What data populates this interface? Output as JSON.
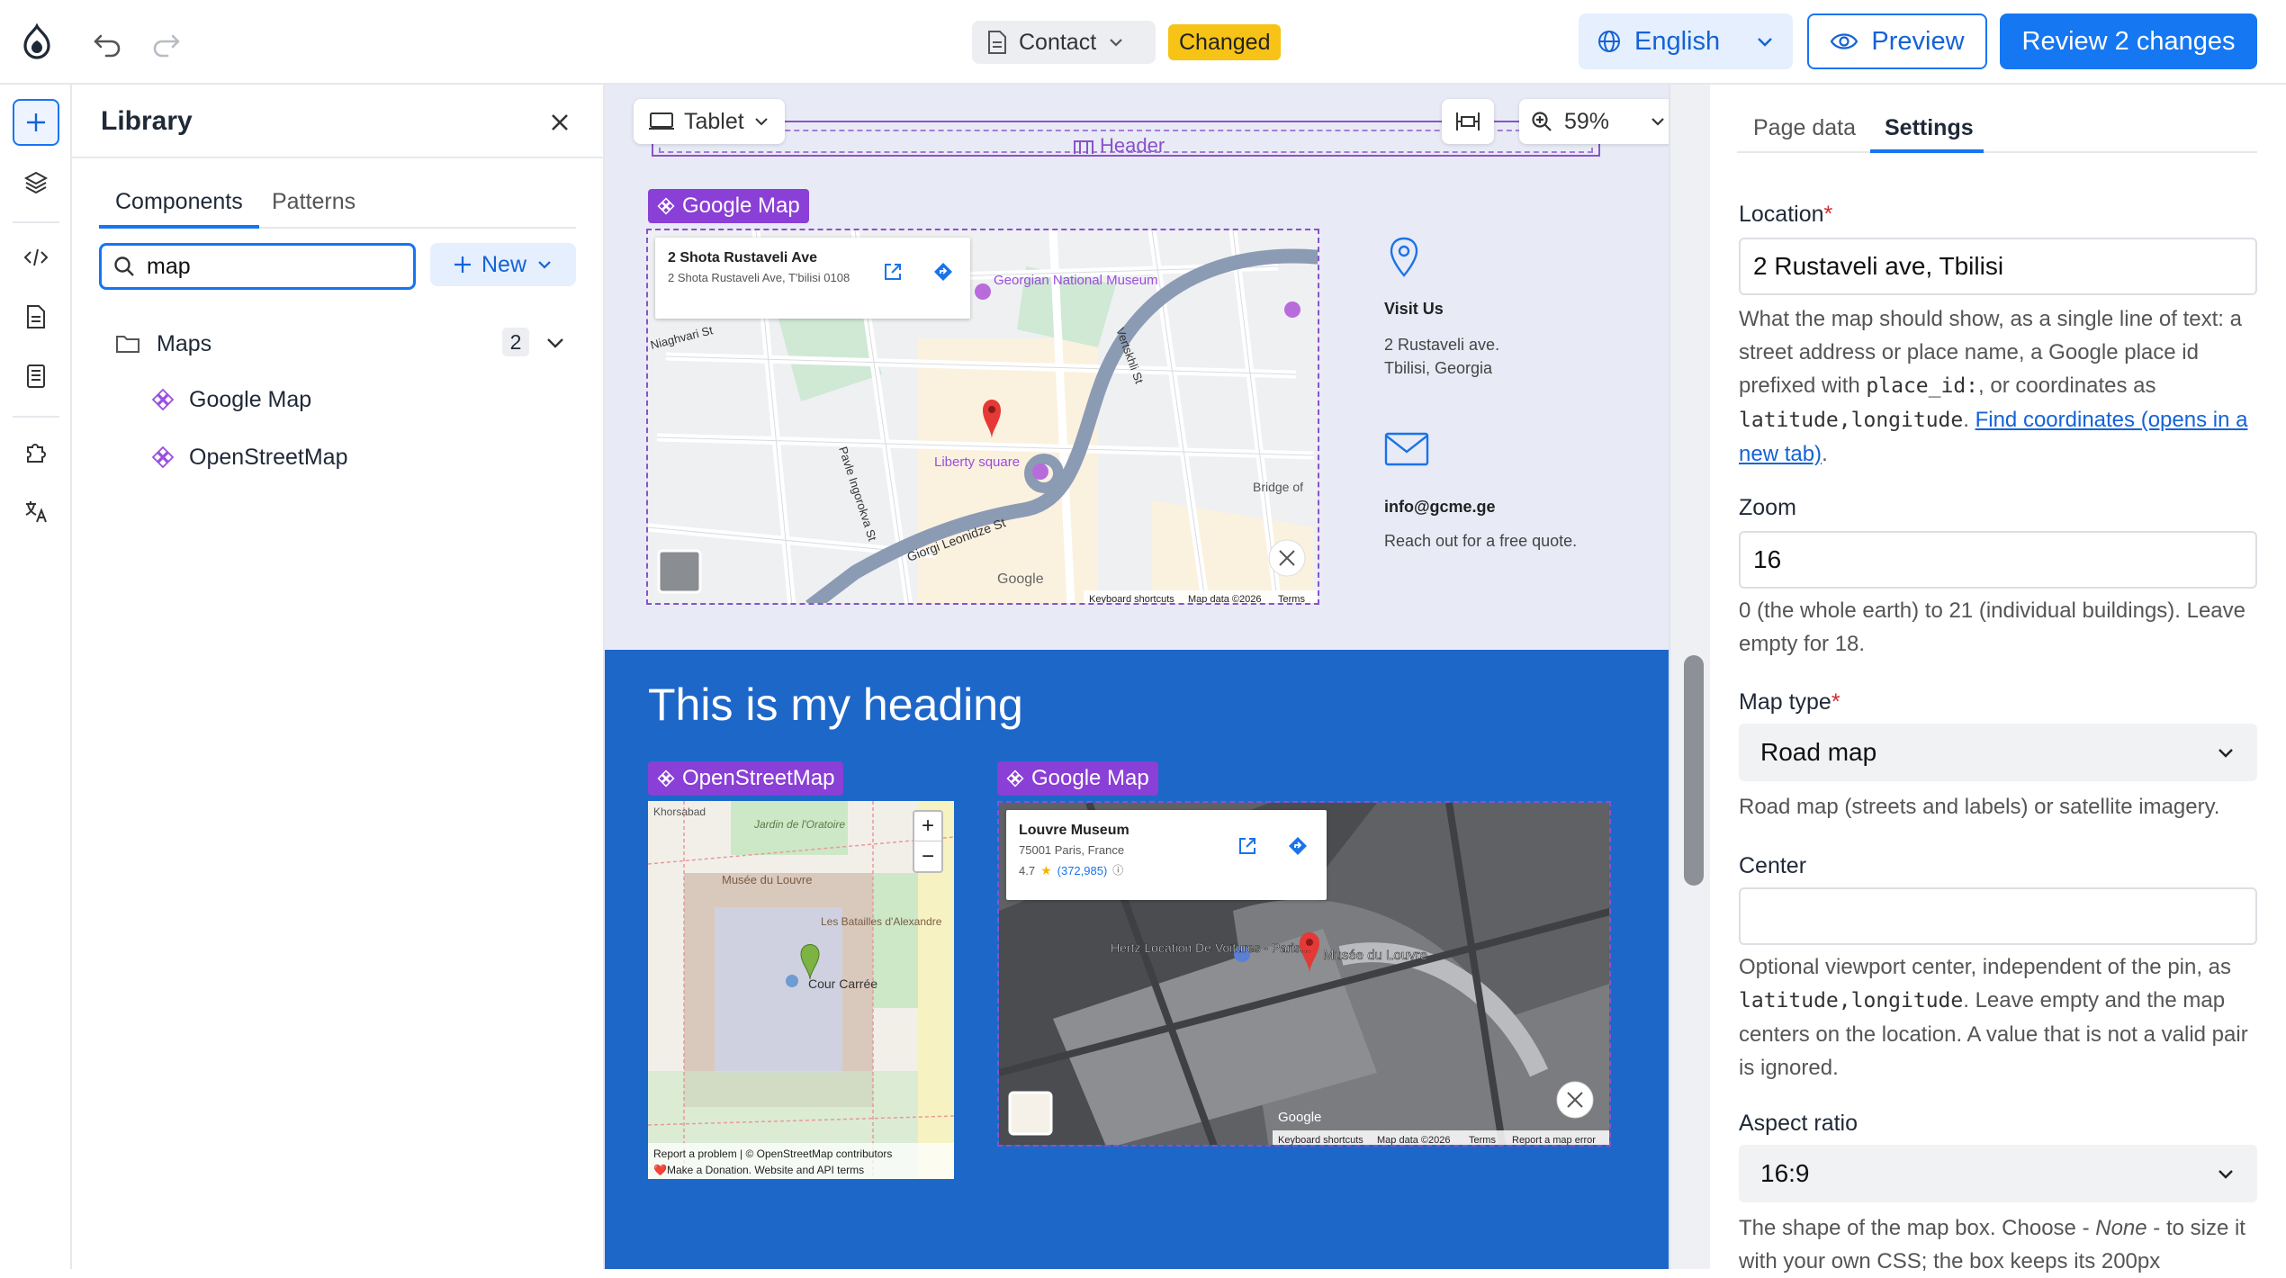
{
  "topbar": {
    "page_name": "Contact",
    "changed_badge": "Changed",
    "language": "English",
    "preview": "Preview",
    "review": "Review 2 changes"
  },
  "library": {
    "title": "Library",
    "tabs": [
      "Components",
      "Patterns"
    ],
    "search_value": "map",
    "new_label": "New",
    "folder": {
      "name": "Maps",
      "count": "2"
    },
    "items": [
      "Google Map",
      "OpenStreetMap"
    ]
  },
  "canvas": {
    "device": "Tablet",
    "zoom": "59%",
    "header_label": "Header",
    "top_map": {
      "tag": "Google Map",
      "card_title": "2 Shota Rustaveli Ave",
      "card_address": "2 Shota Rustaveli Ave, T'bilisi 0108",
      "labels": [
        "Georgian National Museum",
        "Liberty square",
        "Giorgi Leonidze St",
        "Niaghvari St",
        "Vertskhli St",
        "Pavle Ingorokva St",
        "Bridge of",
        "Keyboard shortcuts",
        "Map data ©2026",
        "Terms",
        "Google"
      ]
    },
    "visit": {
      "title": "Visit Us",
      "line1": "2 Rustaveli ave.",
      "line2": "Tbilisi, Georgia"
    },
    "email": {
      "title": "info@gcme.ge",
      "note": "Reach out for a free quote."
    },
    "heading": "This is my heading",
    "osm": {
      "tag": "OpenStreetMap",
      "labels": [
        "Musée du Louvre",
        "Les Batailles d'Alexandre",
        "Cour Carrée",
        "Jardin de l'Oratoire",
        "Khorsabad"
      ],
      "footer1": "Report a problem | © OpenStreetMap contributors",
      "footer2": "❤️Make a Donation. Website and API terms"
    },
    "louvre_map": {
      "tag": "Google Map",
      "card_title": "Louvre Museum",
      "card_address": "75001 Paris, France",
      "rating": "4.7",
      "reviews": "(372,985)",
      "labels": [
        "Hertz Location De Voitures - Paris...",
        "Musée du Louvre",
        "Google",
        "Keyboard shortcuts",
        "Map data ©2026",
        "Terms",
        "Report a map error"
      ]
    }
  },
  "panel": {
    "tabs": [
      "Page data",
      "Settings"
    ],
    "location_label": "Location",
    "location_value": "2 Rustaveli ave, Tbilisi",
    "location_help_1": "What the map should show, as a single line of text: a street address or place name, a Google place id prefixed with ",
    "location_help_code1": "place_id:",
    "location_help_2": ", or coordinates as ",
    "location_help_code2": "latitude,longitude",
    "location_help_3": ". ",
    "location_help_link": "Find coordinates (opens in a new tab)",
    "location_help_4": ".",
    "zoom_label": "Zoom",
    "zoom_value": "16",
    "zoom_help": "0 (the whole earth) to 21 (individual buildings). Leave empty for 18.",
    "maptype_label": "Map type",
    "maptype_value": "Road map",
    "maptype_help": "Road map (streets and labels) or satellite imagery.",
    "center_label": "Center",
    "center_value": "",
    "center_help_1": "Optional viewport center, independent of the pin, as ",
    "center_help_code": "latitude,longitude",
    "center_help_2": ". Leave empty and the map centers on the location. A value that is not a valid pair is ignored.",
    "aspect_label": "Aspect ratio",
    "aspect_value": "16:9",
    "aspect_help_1": "The shape of the map box. Choose - ",
    "aspect_help_em": "None",
    "aspect_help_2": " - to size it with your own CSS; the box keeps its 200px"
  },
  "colors": {
    "accent": "#1677f2",
    "badge": "#f6c316",
    "component_tag": "#8a3fd6",
    "section_blue": "#1d67c9",
    "canvas_bg": "#e8ebf6"
  }
}
